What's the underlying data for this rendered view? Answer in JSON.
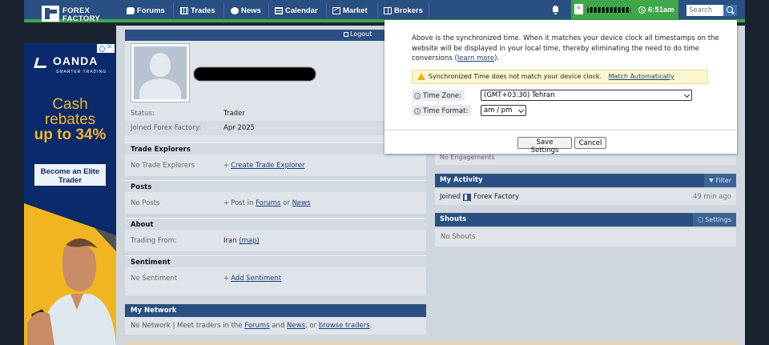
{
  "nav": {
    "logo_line1": "FOREX",
    "logo_line2": "FACTORY",
    "items": [
      {
        "label": "Forums",
        "icon": "forums-icon"
      },
      {
        "label": "Trades",
        "icon": "trades-icon"
      },
      {
        "label": "News",
        "icon": "news-icon"
      },
      {
        "label": "Calendar",
        "icon": "calendar-icon"
      },
      {
        "label": "Market",
        "icon": "market-icon"
      },
      {
        "label": "Brokers",
        "icon": "brokers-icon"
      }
    ],
    "clock": "6:51am",
    "search_placeholder": "Search",
    "colors": {
      "nav_bg": "#2a4f82",
      "accent_green": "#3fa64b"
    }
  },
  "ad": {
    "brand": "OANDA",
    "tagline": "SMARTER TRADING",
    "headline_1": "Cash",
    "headline_2": "rebates",
    "headline_3": "up to 34%",
    "cta": "Become an Elite Trader",
    "colors": {
      "bg": "#0b2a6b",
      "headline": "#f5b526"
    }
  },
  "profile": {
    "logout": "Logout",
    "status_label": "Status:",
    "status_value": "Trader",
    "joined_label": "Joined Forex Factory:",
    "joined_value": "Apr 2025",
    "sections": {
      "trade_explorers": {
        "title": "Trade Explorers",
        "empty": "No Trade Explorers",
        "action": "Create Trade Explorer"
      },
      "posts": {
        "title": "Posts",
        "empty": "No Posts",
        "action_prefix": "Post in",
        "forums": "Forums",
        "or": "or",
        "news": "News"
      },
      "about": {
        "title": "About",
        "trading_from_label": "Trading From:",
        "trading_from_value": "Iran",
        "map": "(map)"
      },
      "sentiment": {
        "title": "Sentiment",
        "empty": "No Sentiment",
        "action": "Add Sentiment"
      }
    },
    "network": {
      "title": "My Network",
      "text_1": "No Network | Meet traders in the",
      "forums": "Forums",
      "and": "and",
      "news": "News",
      "or": ", or",
      "browse": "browse traders",
      "end": "."
    }
  },
  "right": {
    "engagements": "No Engagements",
    "activity_title": "My Activity",
    "filter": "Filter",
    "activity_joined": "Joined",
    "activity_site": "Forex Factory",
    "activity_time": "49 min ago",
    "shouts_title": "Shouts",
    "settings": "Settings",
    "no_shouts": "No Shouts"
  },
  "popup": {
    "intro": "Above is the synchronized time. When it matches your device clock all timestamps on the website will be displayed in your local time, thereby eliminating the need to do time conversions (",
    "learn_more": "learn more",
    "intro_end": ").",
    "warning": "Synchronized Time does not match your device clock.",
    "match": "Match Automatically",
    "tz_label": "Time Zone:",
    "tz_value": "(GMT+03:30) Tehran",
    "fmt_label": "Time Format:",
    "fmt_value": "am / pm",
    "save": "Save Settings",
    "cancel": "Cancel"
  }
}
